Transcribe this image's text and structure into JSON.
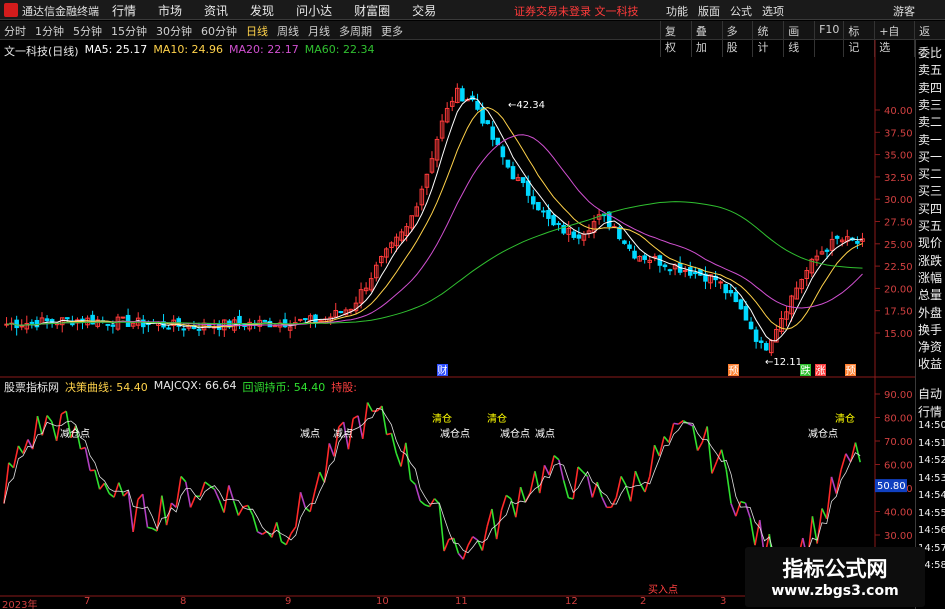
{
  "menubar": {
    "app_title": "通达信金融终端",
    "menus": [
      "行情",
      "市场",
      "资讯",
      "发现",
      "问小达",
      "财富圈",
      "交易"
    ],
    "notice": "证券交易未登录  文一科技",
    "right_items": [
      "功能",
      "版面",
      "公式",
      "选项"
    ],
    "guest": "游客"
  },
  "toolbar": {
    "periods": [
      "分时",
      "1分钟",
      "5分钟",
      "15分钟",
      "30分钟",
      "60分钟",
      "日线",
      "周线",
      "月线",
      "多周期",
      "更多"
    ],
    "active_period": "日线",
    "tools": [
      "复权",
      "叠加",
      "多股",
      "统计",
      "画线",
      "F10",
      "标记",
      "+自选",
      "返回"
    ]
  },
  "main_legend": {
    "title": "文一科技(日线)",
    "ma5": "MA5: 25.17",
    "ma10": "MA10: 24.96",
    "ma20": "MA20: 22.17",
    "ma60": "MA60: 22.34"
  },
  "sub_legend": {
    "title": "股票指标网",
    "s1": "决策曲线: 54.40",
    "s2": "MAJCQX: 66.64",
    "s3": "回调持币: 54.40",
    "s4": "持股:"
  },
  "price_axis": [
    "40.00",
    "37.50",
    "35.00",
    "32.50",
    "30.00",
    "27.50",
    "25.00",
    "22.50",
    "20.00",
    "17.50",
    "15.00"
  ],
  "indicator_axis": [
    "90.00",
    "80.00",
    "70.00",
    "60.00",
    "50.00",
    "40.00",
    "30.00",
    "20.00",
    "10.00"
  ],
  "indicator_current": "50.80",
  "annotations": {
    "high": "42.34",
    "low": "12.11",
    "markers": [
      "财",
      "预",
      "跌",
      "涨",
      "预"
    ],
    "signals": [
      {
        "label": "减仓点",
        "color": "#ffffff"
      },
      {
        "label": "减点",
        "color": "#ffffff"
      },
      {
        "label": "减点",
        "color": "#ffffff"
      },
      {
        "label": "清仓",
        "color": "#ffff00"
      },
      {
        "label": "减仓点",
        "color": "#ffffff"
      },
      {
        "label": "清仓",
        "color": "#ffff00"
      },
      {
        "label": "减仓点",
        "color": "#ffffff"
      },
      {
        "label": "减点",
        "color": "#ffffff"
      },
      {
        "label": "清仓",
        "color": "#ffff00"
      },
      {
        "label": "减仓点",
        "color": "#ffffff"
      },
      {
        "label": "买入点",
        "color": "#ff4040"
      }
    ]
  },
  "side_panel": {
    "top": [
      "委比",
      "卖五",
      "卖四",
      "卖三",
      "卖二",
      "卖一",
      "买一",
      "买二",
      "买三",
      "买四",
      "买五",
      "现价",
      "涨跌",
      "涨幅",
      "总量",
      "外盘",
      "换手",
      "净资",
      "收益"
    ],
    "bottom": [
      "自动",
      "行情",
      "14:50",
      "14:51",
      "14:52",
      "14:53",
      "14:54",
      "14:55",
      "14:56",
      "14:57",
      "14:58"
    ]
  },
  "x_axis": [
    "2023年",
    "7",
    "8",
    "9",
    "10",
    "11",
    "12",
    "2",
    "3",
    "4"
  ],
  "watermark": {
    "line1": "指标公式网",
    "line2": "www.zbgs3.com"
  },
  "colors": {
    "up": "#ff3b3b",
    "down": "#00d8ff",
    "ma5": "#ffffff",
    "ma10": "#ffd24a",
    "ma20": "#d050d0",
    "ma60": "#30c030",
    "accent": "#ffd24a"
  }
}
